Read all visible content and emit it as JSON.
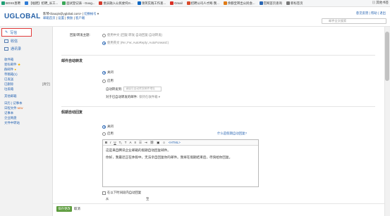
{
  "bookmarks": [
    {
      "label": "BOSS直聘",
      "color": "#1e9e74"
    },
    {
      "label": "【福建】招聘_长工...",
      "color": "#2e7bd6"
    },
    {
      "label": "面试登记表 - Goog...",
      "color": "#3aa757"
    },
    {
      "label": "委员融入公民委托G...",
      "color": "#d33a2c"
    },
    {
      "label": "领英实践工作查...",
      "color": "#0a66c2"
    },
    {
      "label": "Gmail",
      "color": "#d93025"
    },
    {
      "label": "招聘公司人才网-我...",
      "color": "#d94b2b"
    },
    {
      "label": "余额宝转出公民会...",
      "color": "#e07b16"
    },
    {
      "label": "官网首页查询",
      "color": "#2a66b3"
    },
    {
      "label": "新标签页",
      "color": "#777777"
    }
  ],
  "bookmarks_more": "其他书签",
  "header": {
    "logo": "UGLOBAL",
    "logo_sub": "",
    "user": "陈琴<liaoqin@yglobal.com>",
    "user_sep": " | ",
    "switch_account": "切换帐号",
    "links": [
      "邮箱首页",
      "设置",
      "换肤",
      "客户端"
    ],
    "right_links": "意见反馈 | 帮助 | 退出",
    "search_placeholder": "邮件全文搜索"
  },
  "sidebar": {
    "compose": "写信",
    "inbox": "收信",
    "contacts": "通讯录",
    "folders": [
      {
        "label": "收件箱",
        "extra": ""
      },
      {
        "label": "星标邮件",
        "extra": ""
      },
      {
        "label": "群邮件",
        "extra": ""
      },
      {
        "label": "草稿箱",
        "extra": "(1)"
      },
      {
        "label": "已发送",
        "extra": ""
      },
      {
        "label": "已删除",
        "extra": "[清空]"
      },
      {
        "label": "垃圾箱",
        "extra": ""
      }
    ],
    "other": "其他邮箱",
    "tools": [
      {
        "label": "日历",
        "extra": "记事本"
      },
      {
        "label": "日程文件",
        "extra": "NEW"
      },
      {
        "label": "记事本",
        "extra": ""
      },
      {
        "label": "企业网盘",
        "extra": ""
      },
      {
        "label": "文件中转站",
        "extra": ""
      }
    ]
  },
  "content": {
    "reply_subject_label": "回复/转发主题:",
    "reply_opt_cn": "使用中文 (回复:转发:自动回复:自动转发)",
    "reply_opt_en": "使用英文 (Re:,Fw:,AutoReply:,AutoForward:)",
    "forward_title": "邮件自动转发",
    "forward_off": "关闭",
    "forward_on": "启用",
    "forward_to_label": "自动转发到:",
    "forward_to_placeholder": "请填写自动转发邮件地址",
    "forward_after_label": "对于已自动转发的邮件:",
    "forward_after_value": "保持在收件箱",
    "reply_title": "假期自动回复",
    "reply_off": "关闭",
    "reply_on": "启用",
    "reply_link": "什么是假期自动回复?",
    "editor_html": "<HTML>",
    "editor_line1": "这是来自腾讯企业邮箱的假期自动回复邮件。",
    "editor_line2": "你好，我最近正在休假中，无法亲自回复你的邮件。我将在假期结束后，尽快给你回复。",
    "only_time_label": "在以下时间段内自动回复",
    "from_label": "从",
    "to_label": "至"
  },
  "footer": {
    "save": "保存更改",
    "cancel": "取消"
  },
  "colors": {
    "accent": "#2a66b3",
    "save_green": "#5a9a3a",
    "compose_border": "#e23c3c"
  }
}
